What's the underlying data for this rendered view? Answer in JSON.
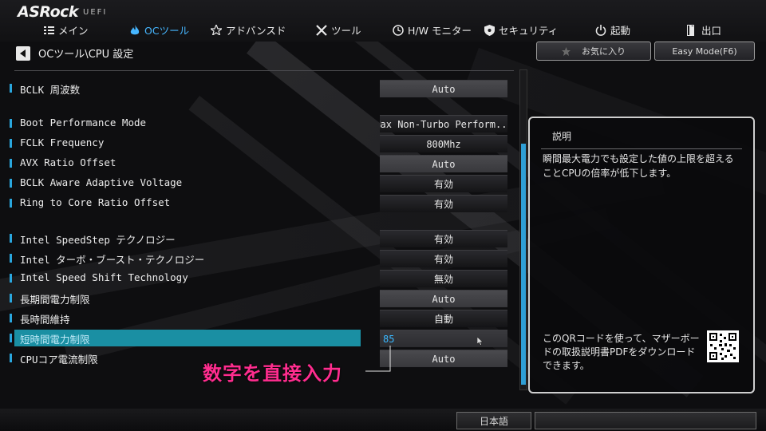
{
  "header": {
    "logo": "ASRock",
    "logo_sub": "UEFI"
  },
  "nav": [
    {
      "label": "メイン",
      "icon": "list-icon",
      "active": false
    },
    {
      "label": "OCツール",
      "icon": "flame-icon",
      "active": true
    },
    {
      "label": "アドバンスド",
      "icon": "star-icon",
      "active": false
    },
    {
      "label": "ツール",
      "icon": "tools-icon",
      "active": false
    },
    {
      "label": "H/W モニター",
      "icon": "monitor-icon",
      "active": false
    },
    {
      "label": "セキュリティ",
      "icon": "shield-icon",
      "active": false
    },
    {
      "label": "起動",
      "icon": "power-icon",
      "active": false
    },
    {
      "label": "出口",
      "icon": "exit-icon",
      "active": false
    }
  ],
  "breadcrumb": "OCツール\\CPU 設定",
  "toolbar": {
    "favorite": "お気に入り",
    "easy_mode": "Easy Mode(F6)"
  },
  "settings": [
    {
      "label": "BCLK 周波数",
      "value": "Auto",
      "style": "grey"
    },
    {
      "label": "Boot Performance Mode",
      "value": "Max Non-Turbo Perform...",
      "style": "dark"
    },
    {
      "label": "FCLK Frequency",
      "value": "800Mhz",
      "style": "dark"
    },
    {
      "label": "AVX Ratio Offset",
      "value": "Auto",
      "style": "grey"
    },
    {
      "label": "BCLK Aware Adaptive Voltage",
      "value": "有効",
      "style": "dark"
    },
    {
      "label": "Ring to Core Ratio Offset",
      "value": "有効",
      "style": "dark"
    },
    {
      "label": "Intel SpeedStep テクノロジー",
      "value": "有効",
      "style": "dark"
    },
    {
      "label": "Intel ターボ・ブースト・テクノロジー",
      "value": "有効",
      "style": "dark"
    },
    {
      "label": "Intel Speed Shift Technology",
      "value": "無効",
      "style": "dark"
    },
    {
      "label": "長期間電力制限",
      "value": "Auto",
      "style": "grey"
    },
    {
      "label": "長時間維持",
      "value": "自動",
      "style": "dark"
    },
    {
      "label": "短時間電力制限",
      "value": "85",
      "style": "input",
      "selected": true
    },
    {
      "label": "CPUコア電流制限",
      "value": "Auto",
      "style": "grey"
    }
  ],
  "description": {
    "title": "説明",
    "text": "瞬間最大電力でも設定した値の上限を超えることCPUの倍率が低下します。",
    "qr_text": "このQRコードを使って、マザーボードの取扱説明書PDFをダウンロードできます。"
  },
  "annotation": "数字を直接入力",
  "footer": {
    "language": "日本語"
  },
  "colors": {
    "accent": "#2aa7de",
    "selected_row": "#1a8fa3",
    "annotation": "#ff2d8f",
    "active_tab": "#46b6ff"
  }
}
